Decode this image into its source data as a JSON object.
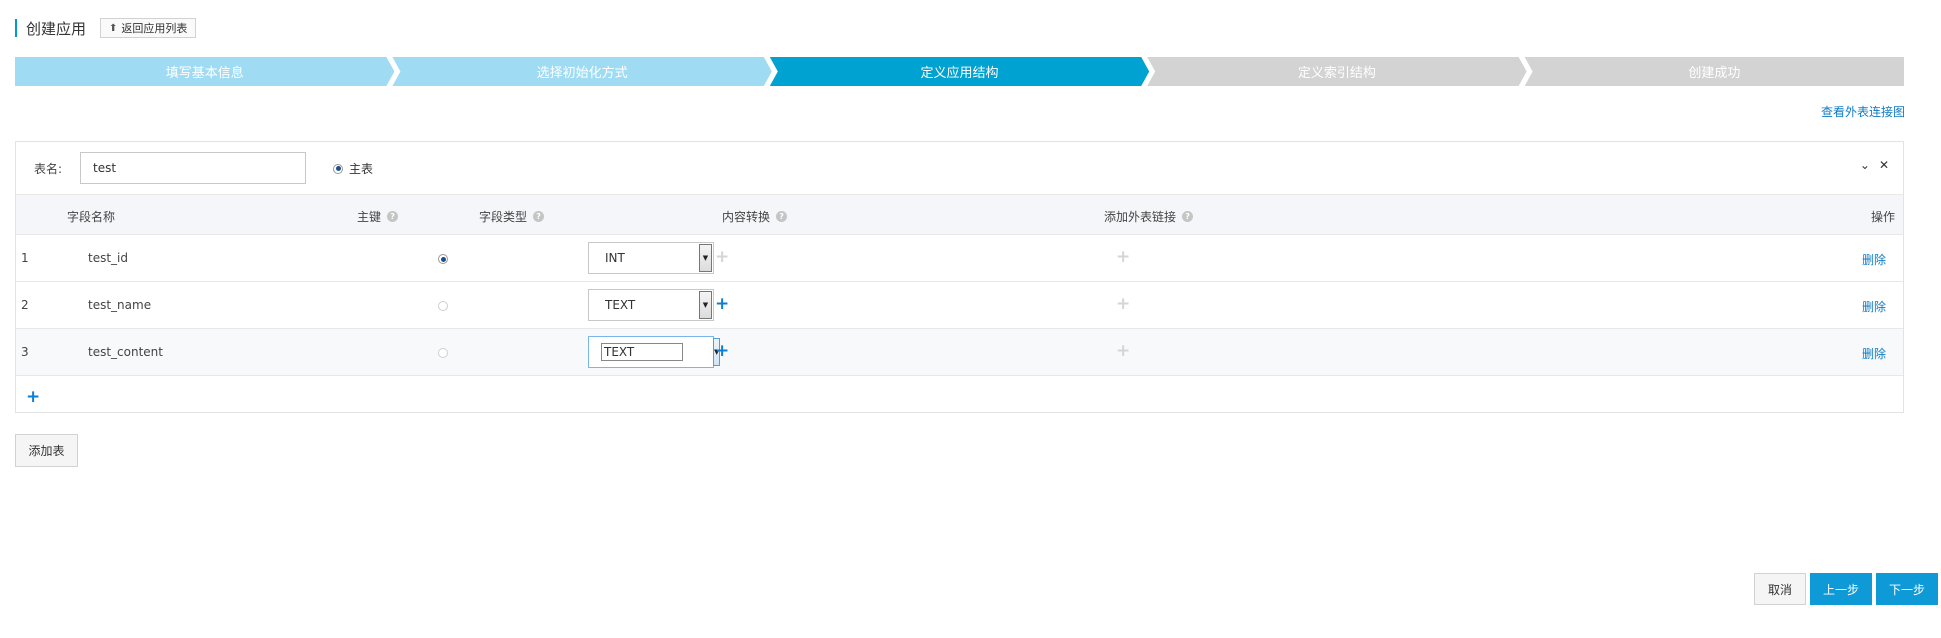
{
  "header": {
    "title": "创建应用",
    "back_label": "返回应用列表"
  },
  "steps": [
    {
      "label": "填写基本信息",
      "state": "done"
    },
    {
      "label": "选择初始化方式",
      "state": "done"
    },
    {
      "label": "定义应用结构",
      "state": "active"
    },
    {
      "label": "定义索引结构",
      "state": "todo"
    },
    {
      "label": "创建成功",
      "state": "todo"
    }
  ],
  "fk_link": "查看外表连接图",
  "table": {
    "name_label": "表名:",
    "name_value": "test",
    "main_label": "主表",
    "tools": [
      "⌄",
      "✕"
    ],
    "columns": {
      "field_name": "字段名称",
      "primary_key": "主键",
      "field_type": "字段类型",
      "content_convert": "内容转换",
      "add_fk": "添加外表链接",
      "operation": "操作"
    },
    "rows": [
      {
        "num": "1",
        "name": "test_id",
        "pk": true,
        "type": "INT",
        "convert_enabled": false,
        "delete": "删除"
      },
      {
        "num": "2",
        "name": "test_name",
        "pk": false,
        "type": "TEXT",
        "convert_enabled": true,
        "delete": "删除"
      },
      {
        "num": "3",
        "name": "test_content",
        "pk": false,
        "type": "TEXT",
        "convert_enabled": true,
        "delete": "删除"
      }
    ]
  },
  "add_table_label": "添加表",
  "footer": {
    "cancel": "取消",
    "prev": "上一步",
    "next": "下一步"
  },
  "colors": {
    "step_done": "#9fdcf4",
    "step_active": "#00a2d1",
    "step_todo": "#d3d3d3",
    "primary_button": "#0d9ad6",
    "link": "#0f7bc4"
  }
}
